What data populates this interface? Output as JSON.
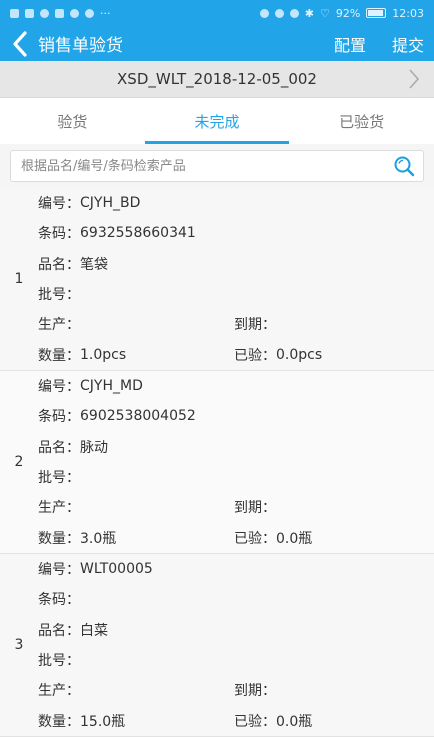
{
  "status_bar": {
    "battery": "92%",
    "time": "12:03"
  },
  "app_bar": {
    "title": "销售单验货",
    "config_label": "配置",
    "submit_label": "提交"
  },
  "order": {
    "number": "XSD_WLT_2018-12-05_002"
  },
  "tabs": [
    {
      "label": "验货",
      "active": false
    },
    {
      "label": "未完成",
      "active": true
    },
    {
      "label": "已验货",
      "active": false
    }
  ],
  "search": {
    "placeholder": "根据品名/编号/条码检索产品",
    "value": ""
  },
  "labels": {
    "code": "编号：",
    "barcode": "条码：",
    "name": "品名：",
    "batch": "批号：",
    "produced": "生产：",
    "expiry": "到期：",
    "quantity": "数量：",
    "checked": "已验："
  },
  "items": [
    {
      "index": "1",
      "code": "CJYH_BD",
      "barcode": "6932558660341",
      "name": "笔袋",
      "batch": "",
      "produced": "",
      "expiry": "",
      "quantity": "1.0pcs",
      "checked": "0.0pcs"
    },
    {
      "index": "2",
      "code": "CJYH_MD",
      "barcode": "6902538004052",
      "name": "脉动",
      "batch": "",
      "produced": "",
      "expiry": "",
      "quantity": "3.0瓶",
      "checked": "0.0瓶"
    },
    {
      "index": "3",
      "code": "WLT00005",
      "barcode": "",
      "name": "白菜",
      "batch": "",
      "produced": "",
      "expiry": "",
      "quantity": "15.0瓶",
      "checked": "0.0瓶"
    }
  ],
  "colors": {
    "primary": "#22a4e8",
    "search_icon": "#1a9fe0"
  }
}
